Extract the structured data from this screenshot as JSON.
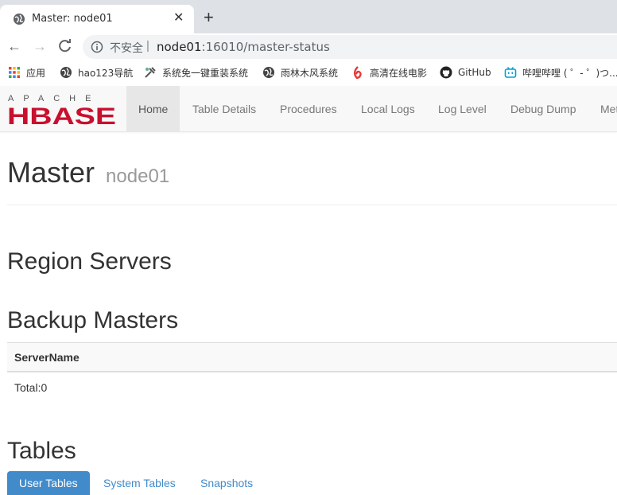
{
  "browser": {
    "tab_title": "Master: node01",
    "tab_close": "✕",
    "new_tab": "+",
    "back": "←",
    "forward": "→",
    "reload": "C",
    "insecure_label": "不安全",
    "separator": "|",
    "url_host": "node01",
    "url_rest": ":16010/master-status",
    "bookmarks": [
      {
        "label": "应用",
        "icon": "apps-grid-icon"
      },
      {
        "label": "hao123导航",
        "icon": "globe-icon"
      },
      {
        "label": "系统免一键重装系统",
        "icon": "tool-icon"
      },
      {
        "label": "雨林木风系统",
        "icon": "globe-icon"
      },
      {
        "label": "高清在线电影",
        "icon": "video-icon"
      },
      {
        "label": "GitHub",
        "icon": "github-icon"
      },
      {
        "label": "哔哩哔哩 ( ゜- ゜)つ...",
        "icon": "bilibili-icon"
      }
    ]
  },
  "navbar": {
    "logo_apache": "APACHE",
    "logo_hbase": "HBASE",
    "items": [
      "Home",
      "Table Details",
      "Procedures",
      "Local Logs",
      "Log Level",
      "Debug Dump",
      "Met"
    ]
  },
  "main": {
    "title": "Master",
    "subtitle": "node01",
    "region_servers": "Region Servers",
    "backup_masters": "Backup Masters",
    "table_header": "ServerName",
    "table_total": "Total:0",
    "tables_heading": "Tables",
    "tabs": [
      "User Tables",
      "System Tables",
      "Snapshots"
    ]
  },
  "colors": {
    "accent": "#428bca",
    "hbase_red": "#c8102e"
  }
}
